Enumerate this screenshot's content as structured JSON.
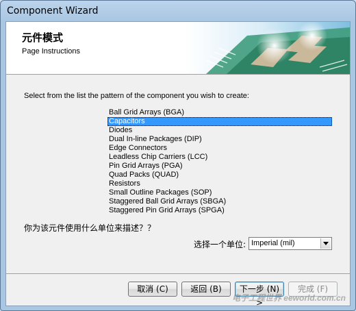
{
  "window": {
    "title": "Component Wizard"
  },
  "header": {
    "title": "元件模式",
    "subtitle": "Page Instructions"
  },
  "prompt": "Select from the list the pattern of the component you wish to create:",
  "patterns": {
    "items": [
      "Ball Grid Arrays (BGA)",
      "Capacitors",
      "Diodes",
      "Dual In-line Packages (DIP)",
      "Edge Connectors",
      "Leadless Chip Carriers (LCC)",
      "Pin Grid Arrays (PGA)",
      "Quad Packs (QUAD)",
      "Resistors",
      "Small Outline Packages (SOP)",
      "Staggered Ball Grid Arrays (SBGA)",
      "Staggered Pin Grid Arrays (SPGA)"
    ],
    "selected": "Capacitors"
  },
  "question": "你为该元件使用什么单位来描述？？",
  "unit": {
    "label": "选择一个单位:",
    "value": "Imperial (mil)"
  },
  "buttons": {
    "cancel": "取消 (C)",
    "back": "返回 (B)",
    "next": "下一步 (N) >",
    "finish": "完成 (F)"
  },
  "watermark": "电子工程世界 eeworld.com.cn"
}
